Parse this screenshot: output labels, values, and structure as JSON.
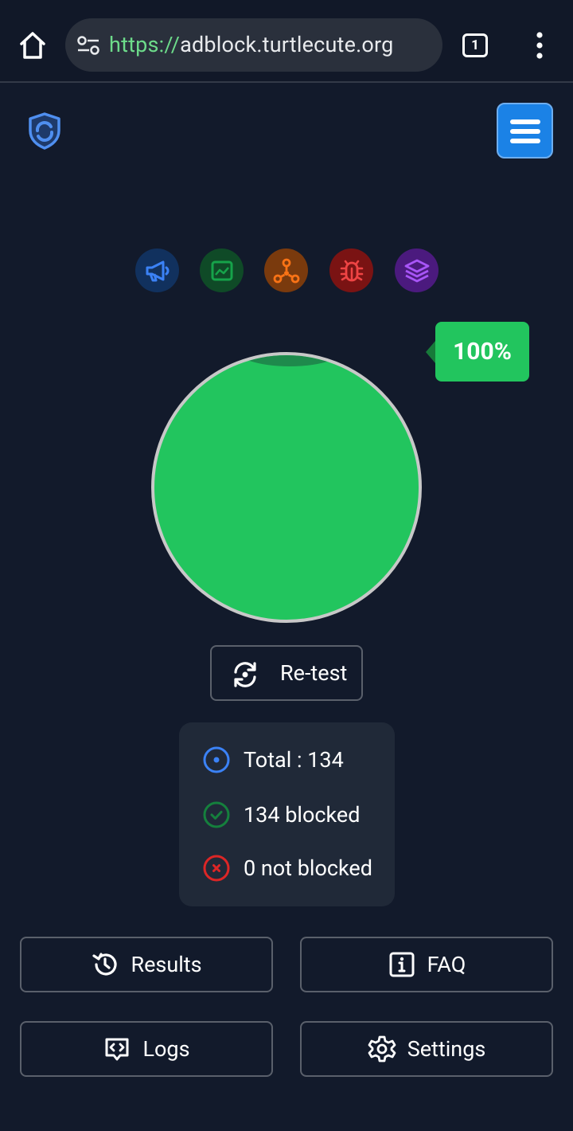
{
  "browser": {
    "url_scheme": "https://",
    "url_host": "adblock.turtlecute.org",
    "tab_count": "1"
  },
  "colors": {
    "background": "#121a2b",
    "accent_blue": "#1b82e6",
    "success_green": "#22c55e",
    "error_red": "#dc2626"
  },
  "categories": [
    {
      "icon": "megaphone-icon",
      "color": "#3b82f6",
      "bg": "#11315e"
    },
    {
      "icon": "chart-icon",
      "color": "#16a34a",
      "bg": "#0f4a27"
    },
    {
      "icon": "network-icon",
      "color": "#f97316",
      "bg": "#7a3a0d"
    },
    {
      "icon": "bug-icon",
      "color": "#ef4444",
      "bg": "#7a1313"
    },
    {
      "icon": "layers-icon",
      "color": "#a855f7",
      "bg": "#4b1a7e"
    }
  ],
  "score": {
    "percent_label": "100%",
    "blocked_fraction": 1.0
  },
  "retest_label": "Re-test",
  "stats": {
    "total": "Total : 134",
    "blocked": "134 blocked",
    "not_blocked": "0 not blocked"
  },
  "actions": {
    "results": "Results",
    "faq": "FAQ",
    "logs": "Logs",
    "settings": "Settings"
  }
}
